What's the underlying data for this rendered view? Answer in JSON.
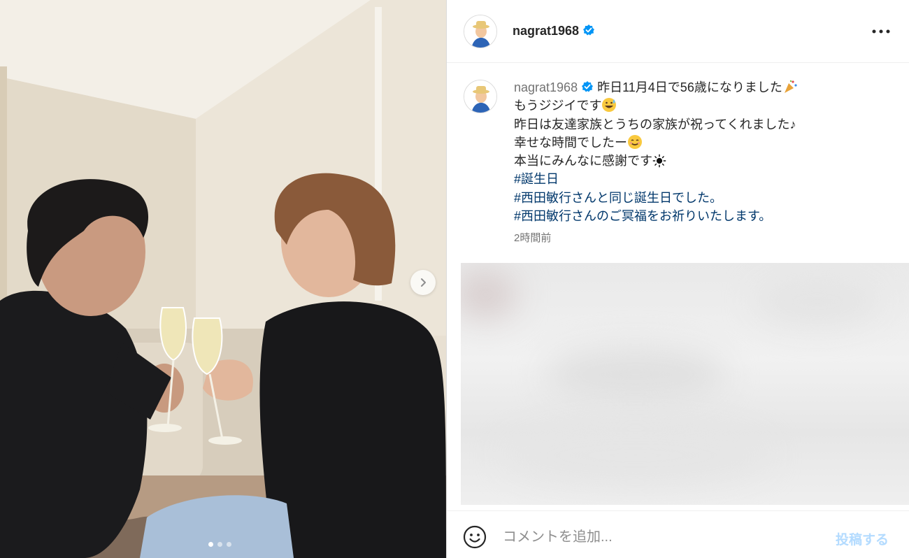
{
  "post": {
    "username": "nagrat1968",
    "verified": true,
    "caption_lines": [
      "昨日11月4日で56歳になりました",
      "もうジジイです",
      "昨日は友達家族とうちの家族が祝ってくれました♪",
      "幸せな時間でしたー",
      "本当にみんなに感謝です"
    ],
    "hashtags": [
      "#誕生日",
      "#西田敏行さんと同じ誕生日でした。",
      "#西田敏行さんのご冥福をお祈りいたします。"
    ],
    "timestamp": "2時間前"
  },
  "carousel": {
    "current": 1,
    "total": 3
  },
  "comment": {
    "placeholder": "コメントを追加...",
    "post_label": "投稿する"
  },
  "icons": {
    "verified": "verified-badge-icon",
    "more": "more-options-icon",
    "next": "chevron-right-icon",
    "emoji_party": "party-popper-icon",
    "emoji_sweat": "grinning-sweat-icon",
    "emoji_smile": "smiling-face-icon",
    "emoji_sun": "sun-icon",
    "smile": "emoji-picker-icon"
  },
  "colors": {
    "hashtag": "#00376b",
    "verified": "#0095f6",
    "muted": "#737373",
    "post_button_disabled": "#b3dbff"
  }
}
